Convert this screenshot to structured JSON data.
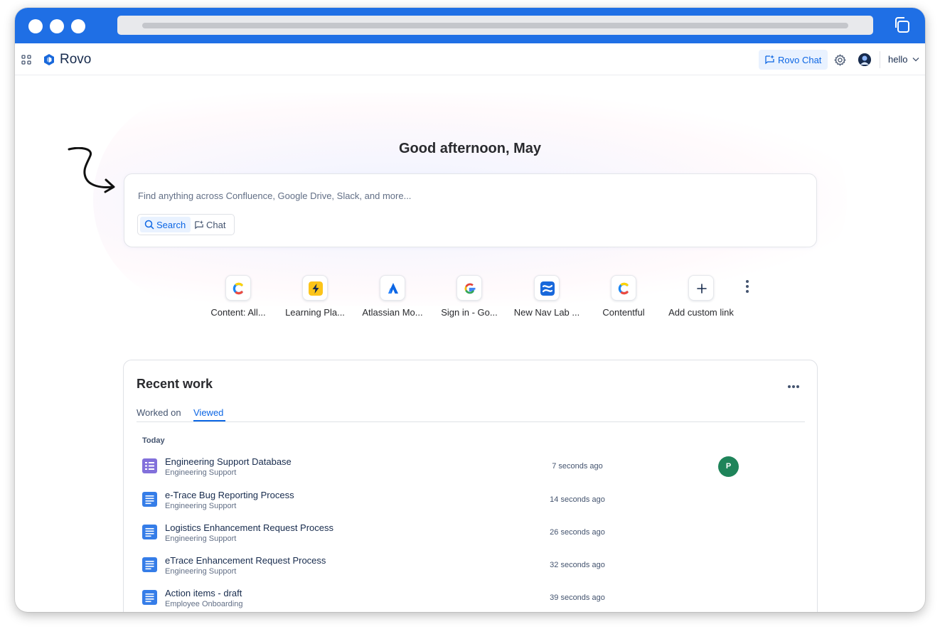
{
  "window_controls": [
    "close",
    "minimize",
    "maximize"
  ],
  "nav": {
    "brand": "Rovo",
    "rovo_chat_label": "Rovo Chat",
    "site_selector": "hello",
    "icons": [
      "app-switcher-icon",
      "rovo-logo-icon",
      "settings-icon",
      "profile-avatar"
    ]
  },
  "home": {
    "greeting": "Good afternoon, May",
    "search_placeholder": "Find anything across Confluence, Google Drive, Slack, and more...",
    "mode_search": "Search",
    "mode_chat": "Chat"
  },
  "shortcuts": [
    {
      "label": "Content: All...",
      "icon": "contentful-icon"
    },
    {
      "label": "Learning Pla...",
      "icon": "lightning-icon"
    },
    {
      "label": "Atlassian Mo...",
      "icon": "atlassian-icon"
    },
    {
      "label": "Sign in - Go...",
      "icon": "google-icon"
    },
    {
      "label": "New Nav Lab ...",
      "icon": "confluence-icon"
    },
    {
      "label": "Contentful",
      "icon": "contentful-icon"
    },
    {
      "label": "Add custom link",
      "icon": "plus-icon"
    }
  ],
  "recent": {
    "title": "Recent work",
    "tabs": [
      "Worked on",
      "Viewed"
    ],
    "active_tab": "Viewed",
    "group_label": "Today",
    "items": [
      {
        "title": "Engineering Support Database",
        "space": "Engineering Support",
        "time": "7 seconds ago",
        "icon": "database-icon",
        "avatar": "P"
      },
      {
        "title": "e-Trace Bug Reporting Process",
        "space": "Engineering Support",
        "time": "14 seconds ago",
        "icon": "page-icon"
      },
      {
        "title": "Logistics Enhancement Request Process",
        "space": "Engineering Support",
        "time": "26 seconds ago",
        "icon": "page-icon"
      },
      {
        "title": "eTrace Enhancement Request Process",
        "space": "Engineering Support",
        "time": "32 seconds ago",
        "icon": "page-icon"
      },
      {
        "title": "Action items - draft",
        "space": "Employee Onboarding",
        "time": "39 seconds ago",
        "icon": "page-icon"
      }
    ]
  },
  "colors": {
    "titlebar": "#1f6fe5",
    "accent": "#0c66e4",
    "accent_bg": "#e9f2ff",
    "avatar_green": "#1f845a",
    "database_purple": "#8270db",
    "page_blue": "#357de8"
  }
}
